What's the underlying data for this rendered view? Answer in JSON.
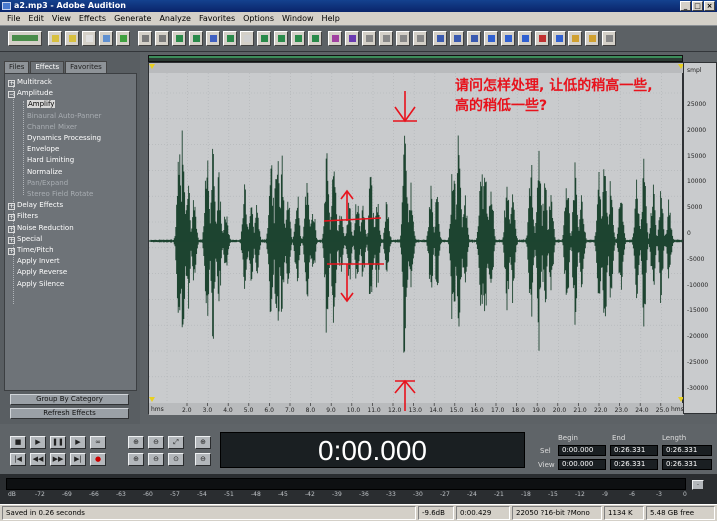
{
  "window": {
    "title": "a2.mp3 - Adobe Audition"
  },
  "menu": [
    "File",
    "Edit",
    "View",
    "Effects",
    "Generate",
    "Analyze",
    "Favorites",
    "Options",
    "Window",
    "Help"
  ],
  "tabs": [
    {
      "label": "Files"
    },
    {
      "label": "Effects"
    },
    {
      "label": "Favorites"
    }
  ],
  "tree": [
    {
      "label": "Multitrack",
      "level": 0,
      "box": "+"
    },
    {
      "label": "Amplitude",
      "level": 0,
      "box": "−"
    },
    {
      "label": "Amplify",
      "level": 1,
      "selected": true
    },
    {
      "label": "Binaural Auto-Panner",
      "level": 1,
      "dim": true
    },
    {
      "label": "Channel Mixer",
      "level": 1,
      "dim": true
    },
    {
      "label": "Dynamics Processing",
      "level": 1
    },
    {
      "label": "Envelope",
      "level": 1
    },
    {
      "label": "Hard Limiting",
      "level": 1
    },
    {
      "label": "Normalize",
      "level": 1
    },
    {
      "label": "Pan/Expand",
      "level": 1,
      "dim": true
    },
    {
      "label": "Stereo Field Rotate",
      "level": 1,
      "dim": true
    },
    {
      "label": "Delay Effects",
      "level": 0,
      "box": "+"
    },
    {
      "label": "Filters",
      "level": 0,
      "box": "+"
    },
    {
      "label": "Noise Reduction",
      "level": 0,
      "box": "+"
    },
    {
      "label": "Special",
      "level": 0,
      "box": "+"
    },
    {
      "label": "Time/Pitch",
      "level": 0,
      "box": "+"
    },
    {
      "label": "Apply Invert",
      "level": 0
    },
    {
      "label": "Apply Reverse",
      "level": 0
    },
    {
      "label": "Apply Silence",
      "level": 0
    }
  ],
  "tree_buttons": {
    "group": "Group By Category",
    "refresh": "Refresh Effects"
  },
  "annotation": "请问怎样处理, 让低的稍高一些, 高的稍低一些?",
  "amp_ruler": {
    "unit": "smpl",
    "ticks": [
      "25000",
      "20000",
      "15000",
      "10000",
      "5000",
      "0",
      "-5000",
      "-10000",
      "-15000",
      "-20000",
      "-25000",
      "-30000"
    ]
  },
  "time_ruler": {
    "unit_left": "hms",
    "unit_right": "hms",
    "ticks": [
      "2.0",
      "3.0",
      "4.0",
      "5.0",
      "6.0",
      "7.0",
      "8.0",
      "9.0",
      "10.0",
      "11.0",
      "12.0",
      "13.0",
      "14.0",
      "15.0",
      "16.0",
      "17.0",
      "18.0",
      "19.0",
      "20.0",
      "21.0",
      "22.0",
      "23.0",
      "24.0",
      "25.0"
    ]
  },
  "time_display": "0:00.000",
  "selview": {
    "headers": {
      "begin": "Begin",
      "end": "End",
      "length": "Length"
    },
    "sel": {
      "label": "Sel",
      "begin": "0:00.000",
      "end": "0:26.331",
      "length": "0:26.331"
    },
    "view": {
      "label": "View",
      "begin": "0:00.000",
      "end": "0:26.331",
      "length": "0:26.331"
    }
  },
  "meter_scale": [
    "dB",
    "-72",
    "-69",
    "-66",
    "-63",
    "-60",
    "-57",
    "-54",
    "-51",
    "-48",
    "-45",
    "-42",
    "-39",
    "-36",
    "-33",
    "-30",
    "-27",
    "-24",
    "-21",
    "-18",
    "-15",
    "-12",
    "-9",
    "-6",
    "-3",
    "0"
  ],
  "status": {
    "left": "Saved in 0.26 seconds",
    "level": "-9.6dB @",
    "pos": "0:00.429",
    "format": "22050 ?16-bit ?Mono",
    "size": "1134 K",
    "free": "5.48 GB free"
  },
  "colors": {
    "waveform": "#1d4430",
    "annotation": "#e8121c",
    "background": "#c9cbcd"
  }
}
